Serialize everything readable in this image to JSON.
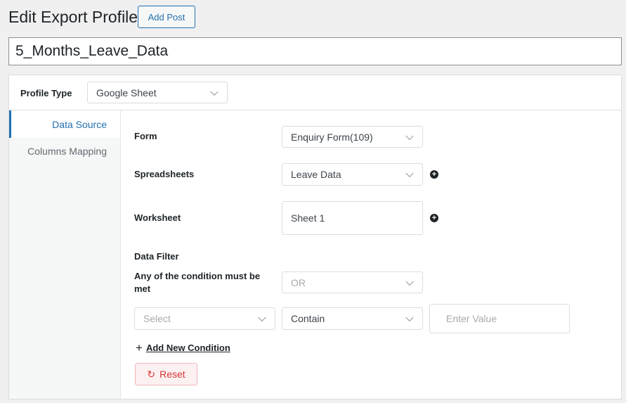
{
  "header": {
    "title": "Edit Export Profile",
    "add_post_label": "Add Post"
  },
  "profile_name": "5_Months_Leave_Data",
  "profile_type": {
    "label": "Profile Type",
    "value": "Google Sheet"
  },
  "sidebar": {
    "items": [
      {
        "label": "Data Source",
        "active": true
      },
      {
        "label": "Columns Mapping",
        "active": false
      }
    ]
  },
  "form": {
    "form_label": "Form",
    "form_value": "Enquiry Form(109)",
    "spreadsheets_label": "Spreadsheets",
    "spreadsheets_value": "Leave Data",
    "worksheet_label": "Worksheet",
    "worksheet_value": "Sheet 1",
    "add_icon": "+"
  },
  "filter": {
    "heading": "Data Filter",
    "condition_label": "Any of the condition must be met",
    "condition_value": "OR",
    "field_placeholder": "Select",
    "operator_value": "Contain",
    "value_placeholder": "Enter Value",
    "add_condition_icon": "+",
    "add_condition_label": "Add New Condition",
    "reset_icon": "↻",
    "reset_label": "Reset"
  },
  "colors": {
    "accent": "#2271b1",
    "danger": "#d63638"
  }
}
